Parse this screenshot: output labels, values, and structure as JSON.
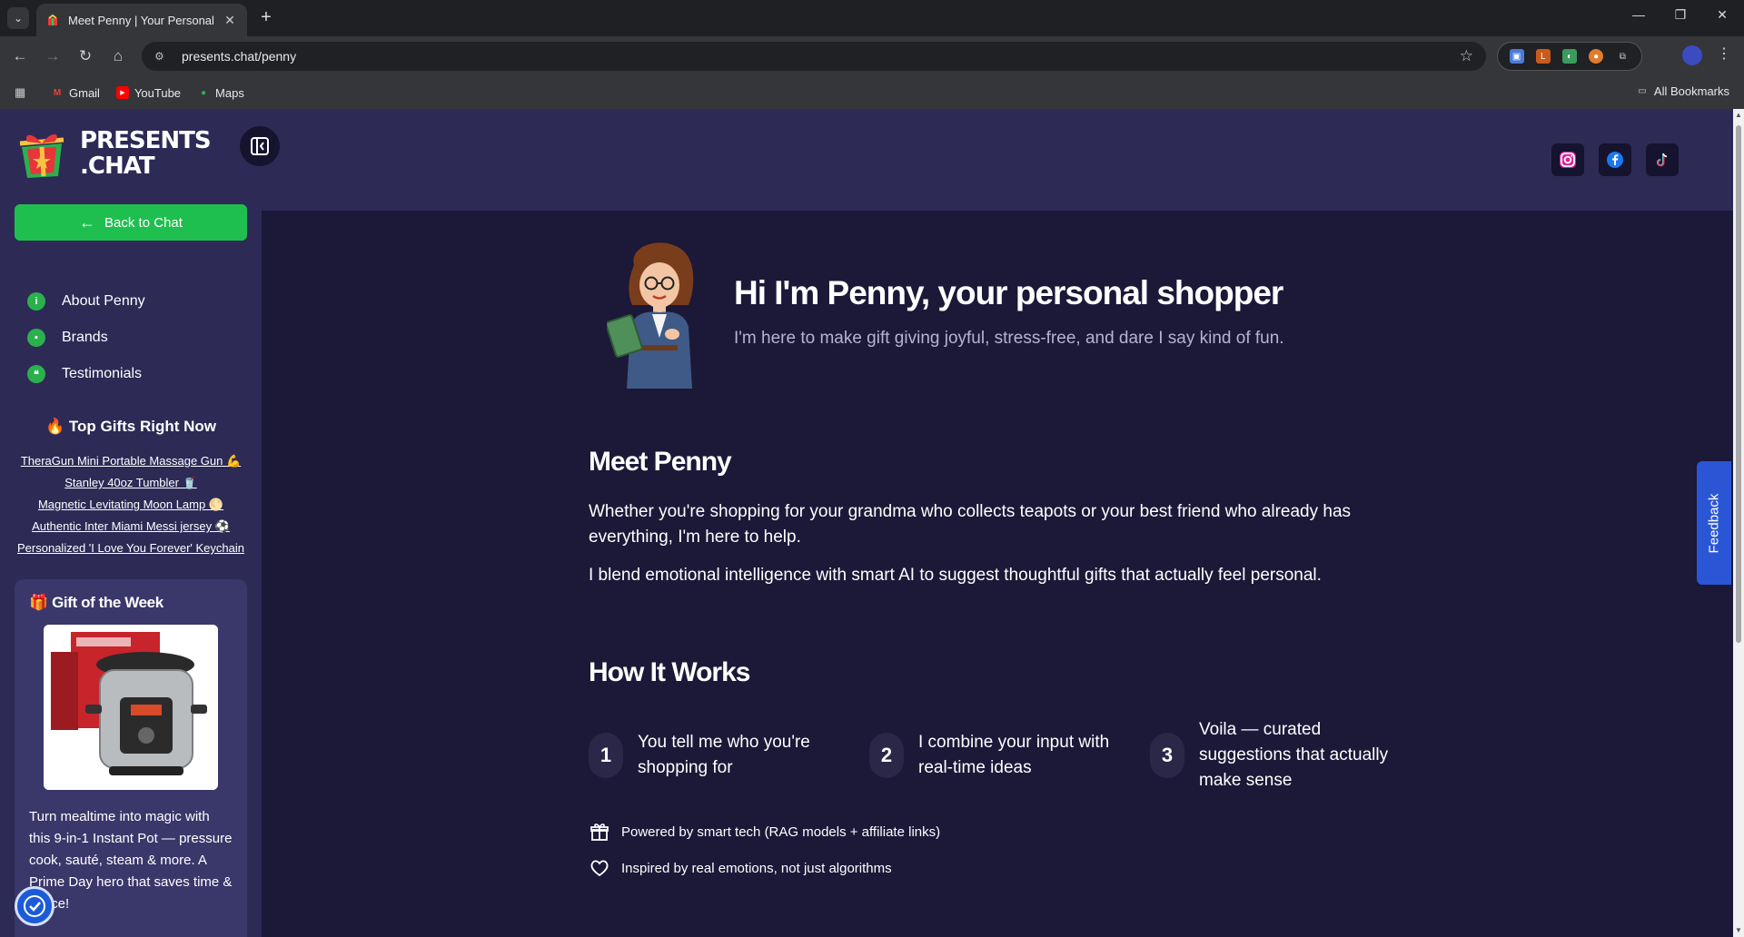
{
  "browser": {
    "tab_title": "Meet Penny | Your Personal Shopper",
    "url": "presents.chat/penny",
    "bookmarks": [
      "Gmail",
      "YouTube",
      "Maps"
    ],
    "all_bookmarks": "All Bookmarks"
  },
  "sidebar": {
    "logo_line1": "PRESENTS",
    "logo_line2": ".CHAT",
    "back_button": "Back to Chat",
    "nav": [
      {
        "label": "About Penny"
      },
      {
        "label": "Brands"
      },
      {
        "label": "Testimonials"
      }
    ],
    "top_gifts_title": "🔥 Top Gifts Right Now",
    "top_gifts": [
      "TheraGun Mini Portable Massage Gun 💪",
      "Stanley 40oz Tumbler 🥤",
      "Magnetic Levitating Moon Lamp 🌕",
      "Authentic Inter Miami Messi jersey ⚽",
      "Personalized 'I Love You Forever' Keychain"
    ],
    "gift_of_week_title": "🎁 Gift of the Week",
    "gift_of_week_text": "Turn mealtime into magic with this 9-in-1 Instant Pot — pressure cook, sauté, steam & more. A Prime Day hero that saves time & space!"
  },
  "hero": {
    "title": "Hi I'm Penny, your personal shopper",
    "subtitle": "I'm here to make gift giving joyful, stress-free, and dare I say kind of fun."
  },
  "meet": {
    "title": "Meet Penny",
    "p1": "Whether you're shopping for your grandma who collects teapots or your best friend who already has everything, I'm here to help.",
    "p2": "I blend emotional intelligence with smart AI to suggest thoughtful gifts that actually feel personal."
  },
  "how": {
    "title": "How It Works",
    "steps": [
      {
        "num": "1",
        "text": "You tell me who you're shopping for"
      },
      {
        "num": "2",
        "text": "I combine your input with real-time ideas"
      },
      {
        "num": "3",
        "text": "Voila — curated suggestions that actually make sense"
      }
    ],
    "note1": "Powered by smart tech (RAG models + affiliate links)",
    "note2": "Inspired by real emotions, not just algorithms"
  },
  "feedback_label": "Feedback",
  "colors": {
    "accent_green": "#1fbf4f",
    "sidebar_bg": "#2d2a56",
    "main_bg": "#1b1838",
    "feedback_blue": "#2a56d6"
  },
  "icons": [
    "instagram-icon",
    "facebook-icon",
    "tiktok-icon",
    "gift-icon",
    "heart-icon",
    "info-icon",
    "accessibility-icon"
  ]
}
